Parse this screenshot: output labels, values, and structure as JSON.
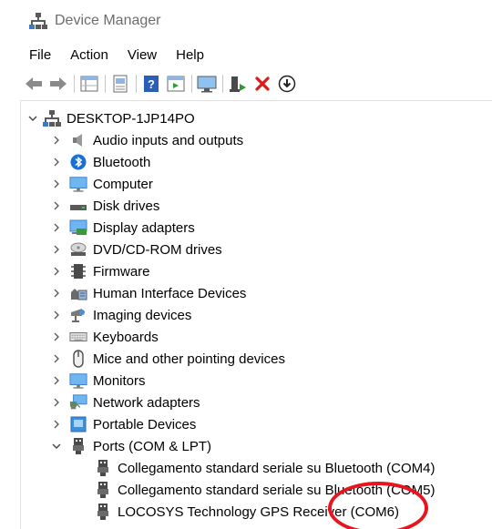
{
  "window": {
    "title": "Device Manager"
  },
  "menu": {
    "items": [
      {
        "id": "file",
        "label": "File"
      },
      {
        "id": "action",
        "label": "Action"
      },
      {
        "id": "view",
        "label": "View"
      },
      {
        "id": "help",
        "label": "Help"
      }
    ]
  },
  "toolbar": {
    "buttons": [
      "back-arrow-icon",
      "forward-arrow-icon",
      "properties-grid-icon",
      "document-icon",
      "help-question-icon",
      "run-panel-icon",
      "monitor-scan-icon",
      "update-driver-icon",
      "uninstall-x-icon",
      "download-circle-icon"
    ]
  },
  "tree": {
    "root": {
      "label": "DESKTOP-1JP14PO",
      "expanded": true
    },
    "categories": [
      {
        "label": "Audio inputs and outputs",
        "icon": "speaker-icon",
        "expanded": false
      },
      {
        "label": "Bluetooth",
        "icon": "bluetooth-icon",
        "expanded": false
      },
      {
        "label": "Computer",
        "icon": "computer-icon",
        "expanded": false
      },
      {
        "label": "Disk drives",
        "icon": "disk-drive-icon",
        "expanded": false
      },
      {
        "label": "Display adapters",
        "icon": "display-adapter-icon",
        "expanded": false
      },
      {
        "label": "DVD/CD-ROM drives",
        "icon": "dvd-icon",
        "expanded": false
      },
      {
        "label": "Firmware",
        "icon": "firmware-chip-icon",
        "expanded": false
      },
      {
        "label": "Human Interface Devices",
        "icon": "hid-icon",
        "expanded": false
      },
      {
        "label": "Imaging devices",
        "icon": "camera-icon",
        "expanded": false
      },
      {
        "label": "Keyboards",
        "icon": "keyboard-icon",
        "expanded": false
      },
      {
        "label": "Mice and other pointing devices",
        "icon": "mouse-icon",
        "expanded": false
      },
      {
        "label": "Monitors",
        "icon": "monitor-icon",
        "expanded": false
      },
      {
        "label": "Network adapters",
        "icon": "network-adapter-icon",
        "expanded": false
      },
      {
        "label": "Portable Devices",
        "icon": "portable-device-icon",
        "expanded": false
      },
      {
        "label": "Ports (COM & LPT)",
        "icon": "port-icon",
        "expanded": true
      }
    ],
    "ports_children": [
      {
        "label": "Collegamento standard seriale su Bluetooth (COM4)",
        "icon": "port-icon"
      },
      {
        "label": "Collegamento standard seriale su Bluetooth (COM5)",
        "icon": "port-icon"
      },
      {
        "label": "LOCOSYS Technology GPS Receiver (COM6)",
        "icon": "port-icon"
      }
    ]
  },
  "annotation": {
    "color": "#e8141e",
    "shape": "ellipse"
  }
}
